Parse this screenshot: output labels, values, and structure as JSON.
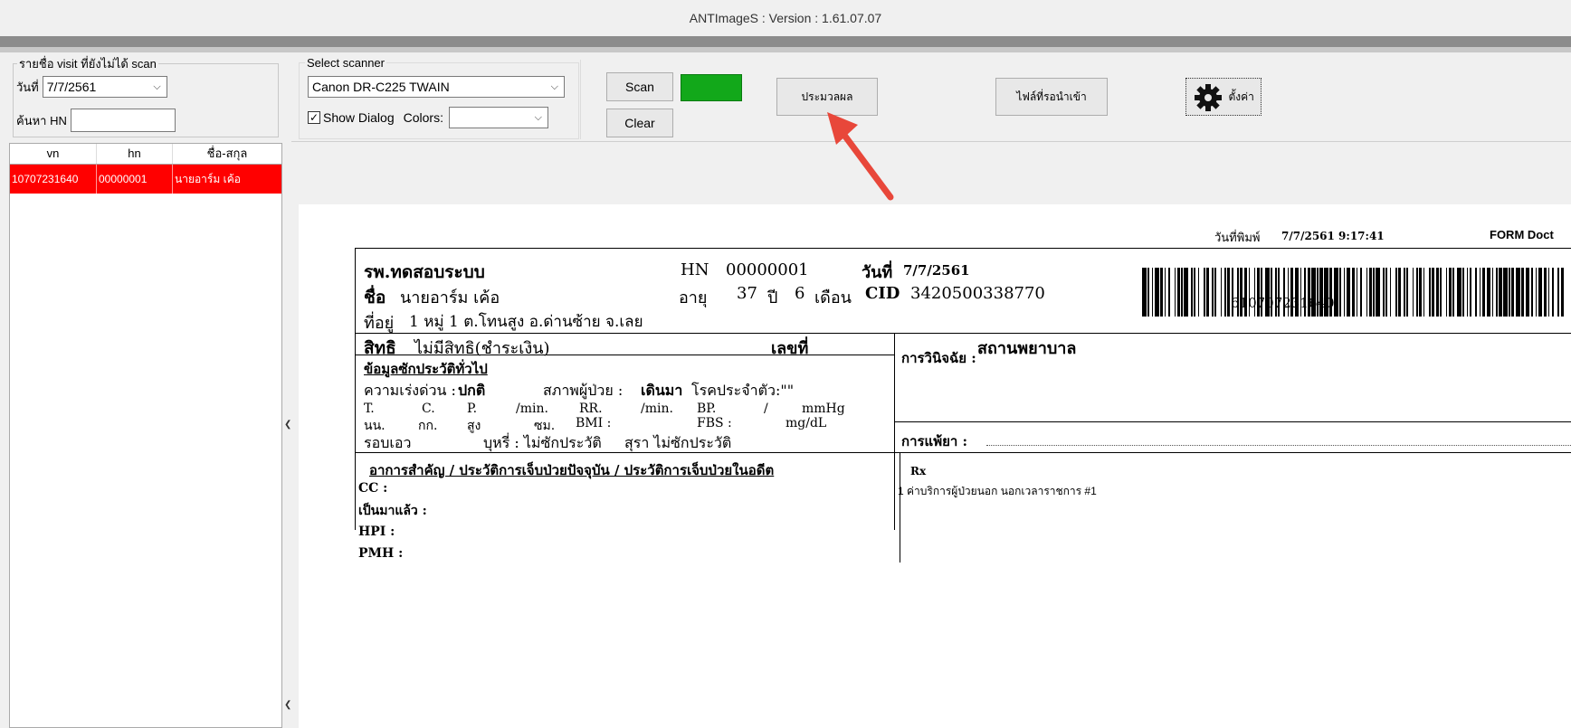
{
  "window": {
    "title": "ANTImageS : Version : 1.61.07.07"
  },
  "left": {
    "group_title": "รายชื่อ visit ที่ยังไม่ได้ scan",
    "date_label": "วันที่",
    "date_value": "7/7/2561",
    "hn_label": "ค้นหา HN",
    "hn_value": "",
    "columns": [
      "vn",
      "hn",
      "ชื่อ-สกุล"
    ],
    "rows": [
      {
        "vn": "10707231640",
        "hn": "00000001",
        "name": "นายอาร์ม เค้อ"
      }
    ]
  },
  "scanner": {
    "group_title": "Select scanner",
    "selected": "Canon DR-C225 TWAIN",
    "show_dialog_label": "Show Dialog",
    "show_dialog_checked": true,
    "colors_label": "Colors:",
    "colors_value": ""
  },
  "toolbar": {
    "scan_label": "Scan",
    "clear_label": "Clear",
    "process_label": "ประมวลผล",
    "pending_files_label": "ไฟล์ที่รอนำเข้า",
    "settings_label": "ตั้งค่า",
    "status_color": "#12a81a"
  },
  "document": {
    "print_date_label": "วันที่พิมพ์",
    "print_date_value": "7/7/2561 9:17:41",
    "form_label": "FORM Doct",
    "hospital": "รพ.ทดสอบระบบ",
    "hn_label": "HN",
    "hn_value": "00000001",
    "date_label": "วันที่",
    "date_value": "7/7/2561",
    "name_label": "ชื่อ",
    "name_value": "นายอาร์ม เค้อ",
    "age_label": "อายุ",
    "age_years": "37",
    "years_label": "ปี",
    "age_months": "6",
    "months_label": "เดือน",
    "cid_label": "CID",
    "cid_value": "3420500338770",
    "address_label": "ที่อยู่",
    "address_value": "1 หมู่ 1 ต.โทนสูง อ.ด่านซ้าย จ.เลย",
    "right_label": "สิทธิ",
    "right_value": "ไม่มีสิทธิ(ชำระเงิน)",
    "number_label": "เลขที่",
    "place_label": "สถานพยาบาล",
    "barcode_number": "610707231640",
    "general_title": "ข้อมูลซักประวัติทั่วไป",
    "urgency_label": "ความเร่งด่วน :",
    "urgency_value": "ปกติ",
    "patient_state_label": "สภาพผู้ป่วย :",
    "patient_state_value": "เดินมา",
    "chronic_label": "โรคประจำตัว:\"\"",
    "vitals_row1": [
      "T.",
      "C.",
      "P.",
      "/min.",
      "RR.",
      "/min.",
      "BP.",
      "/",
      "mmHg"
    ],
    "vitals_row2": [
      "นน.",
      "กก.",
      "สูง",
      "ซม.",
      "BMI :",
      "FBS :",
      "mg/dL"
    ],
    "waist_label": "รอบเอว",
    "smoke_label": "บุหรี่ : ไม่ซักประวัติ",
    "alcohol_label": "สุรา  ไม่ซักประวัติ",
    "diagnosis_label": "การวินิจฉัย :",
    "allergy_label": "การแพ้ยา :",
    "history_title": "อาการสำคัญ / ประวัติการเจ็บป่วยปัจจุบัน / ประวัติการเจ็บป่วยในอดีต",
    "cc_label": "CC :",
    "since_label": "เป็นมาแล้ว :",
    "hpi_label": "HPI :",
    "pmh_label": "PMH :",
    "rx_label": "Rx",
    "rx_item": "1  ค่าบริการผู้ป่วยนอก นอกเวลาราชการ #1"
  }
}
